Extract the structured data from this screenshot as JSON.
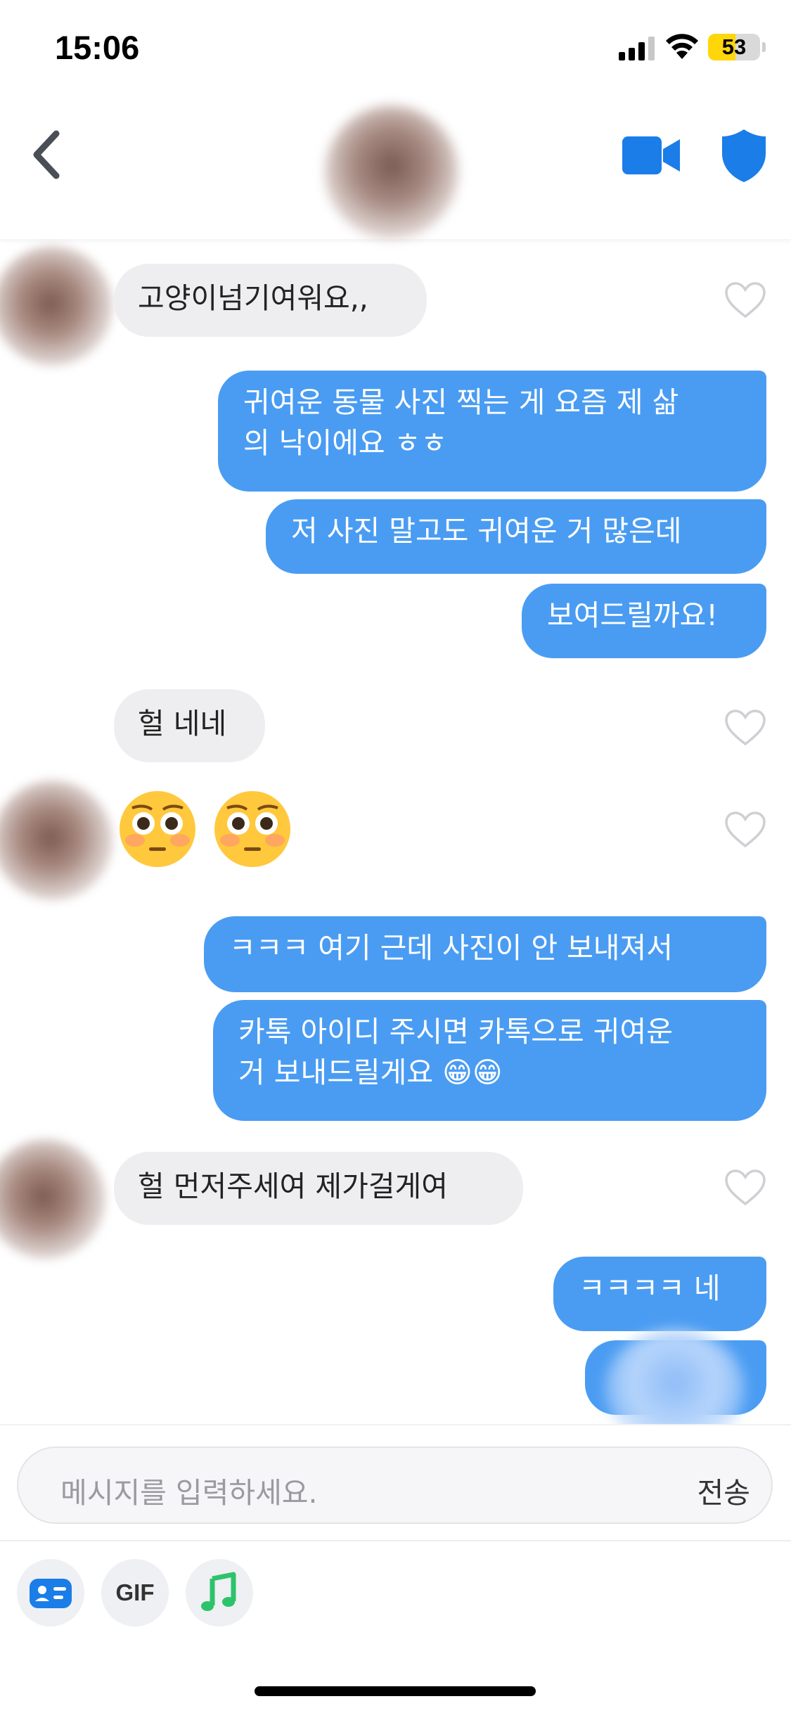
{
  "status_bar": {
    "time": "15:06",
    "battery": "53",
    "battery_level": 0.53
  },
  "header": {
    "back_icon": "chevron-left-icon",
    "video_icon": "video-camera-icon",
    "shield_icon": "shield-icon"
  },
  "messages": [
    {
      "side": "in",
      "text": "고양이넘기여워요,,"
    },
    {
      "side": "out",
      "text": "귀여운 동물 사진 찍는 게 요즘 제 삶\n의 낙이에요 ㅎㅎ"
    },
    {
      "side": "out",
      "text": "저 사진 말고도 귀여운 거 많은데"
    },
    {
      "side": "out",
      "text": "보여드릴까요!"
    },
    {
      "side": "in",
      "text": "헐 네네"
    },
    {
      "side": "in",
      "text": "😳 😳"
    },
    {
      "side": "out",
      "text": "ㅋㅋㅋ 여기 근데 사진이 안 보내져서"
    },
    {
      "side": "out",
      "text": "카톡 아이디 주시면 카톡으로 귀여운\n거 보내드릴게요 😁😁"
    },
    {
      "side": "in",
      "text": "헐 먼저주세여 제가걸게여"
    },
    {
      "side": "out",
      "text": "ㅋㅋㅋㅋ 네"
    }
  ],
  "composer": {
    "placeholder": "메시지를 입력하세요.",
    "send_label": "전송"
  },
  "toolbar": {
    "gif_label": "GIF"
  },
  "colors": {
    "outgoing_bubble": "#4a9cf2",
    "incoming_bubble": "#eeeef0",
    "accent": "#1a7de8",
    "music": "#2cc36b"
  }
}
